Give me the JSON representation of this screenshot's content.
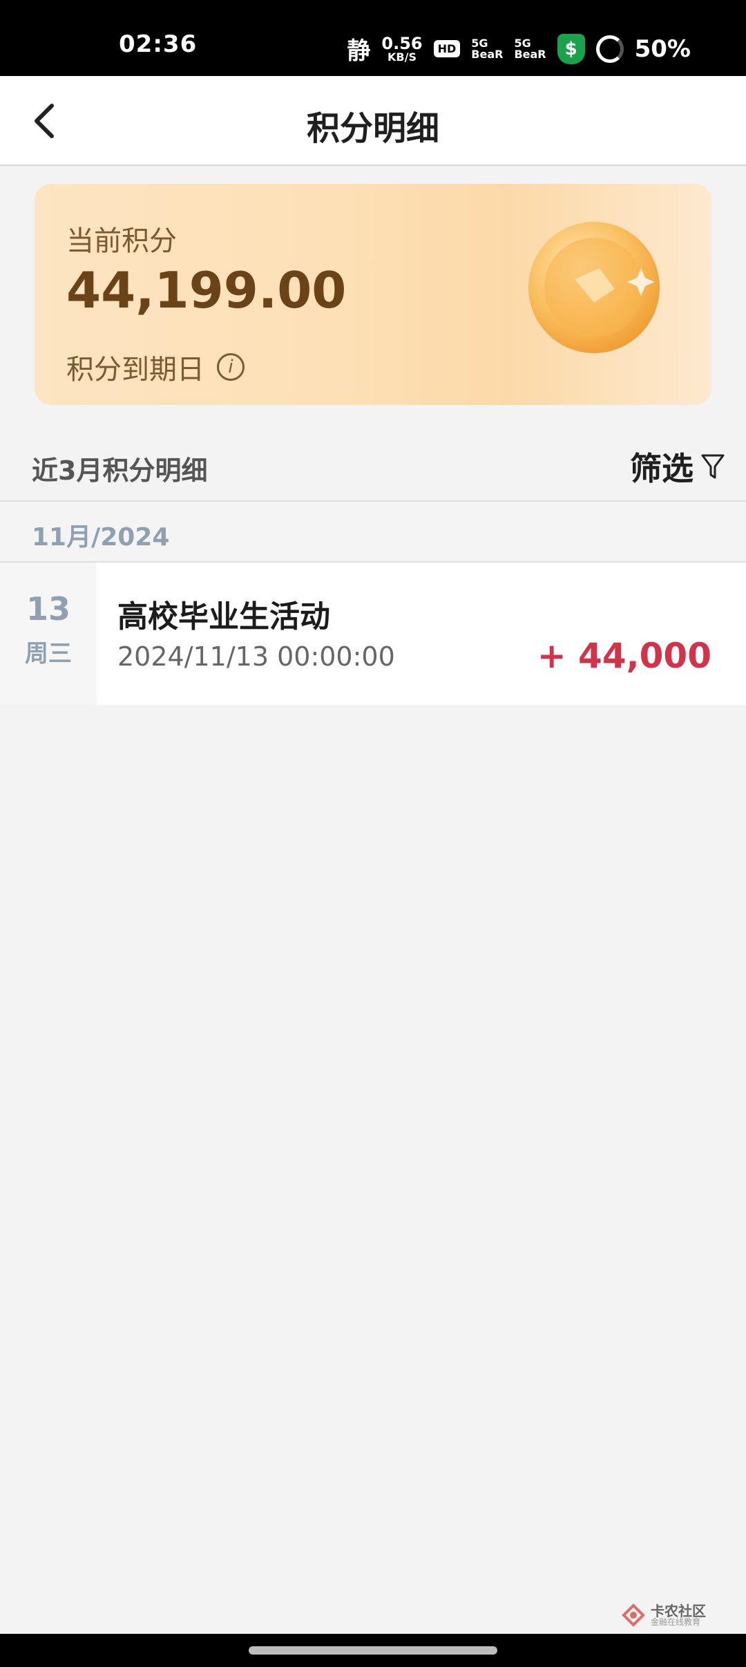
{
  "status": {
    "time": "02:36",
    "quiet": "静",
    "net_speed": "0.56",
    "net_unit": "KB/S",
    "hd": "HD",
    "sim1_5g": "5G",
    "sim1_label": "BeaR",
    "sim2_5g": "5G",
    "sim2_label": "BeaR",
    "shield_symbol": "$",
    "battery": "50%"
  },
  "header": {
    "title": "积分明细"
  },
  "card": {
    "label": "当前积分",
    "value": "44,199.00",
    "expiry_label": "积分到期日",
    "info_symbol": "i"
  },
  "section": {
    "title": "近3月积分明细",
    "filter_label": "筛选"
  },
  "month": {
    "label": "11月/2024"
  },
  "transactions": [
    {
      "day": "13",
      "weekday": "周三",
      "title": "高校毕业生活动",
      "time": "2024/11/13 00:00:00",
      "amount": "+ 44,000"
    }
  ],
  "watermark": {
    "title": "卡农社区",
    "subtitle": "金融在线教育"
  },
  "colors": {
    "amount": "#d3334a",
    "card_text": "#6a4318",
    "date_text": "#8fa1b0"
  },
  "icons": [
    "back-icon",
    "info-icon",
    "filter-icon",
    "coin-icon",
    "shield-icon"
  ]
}
